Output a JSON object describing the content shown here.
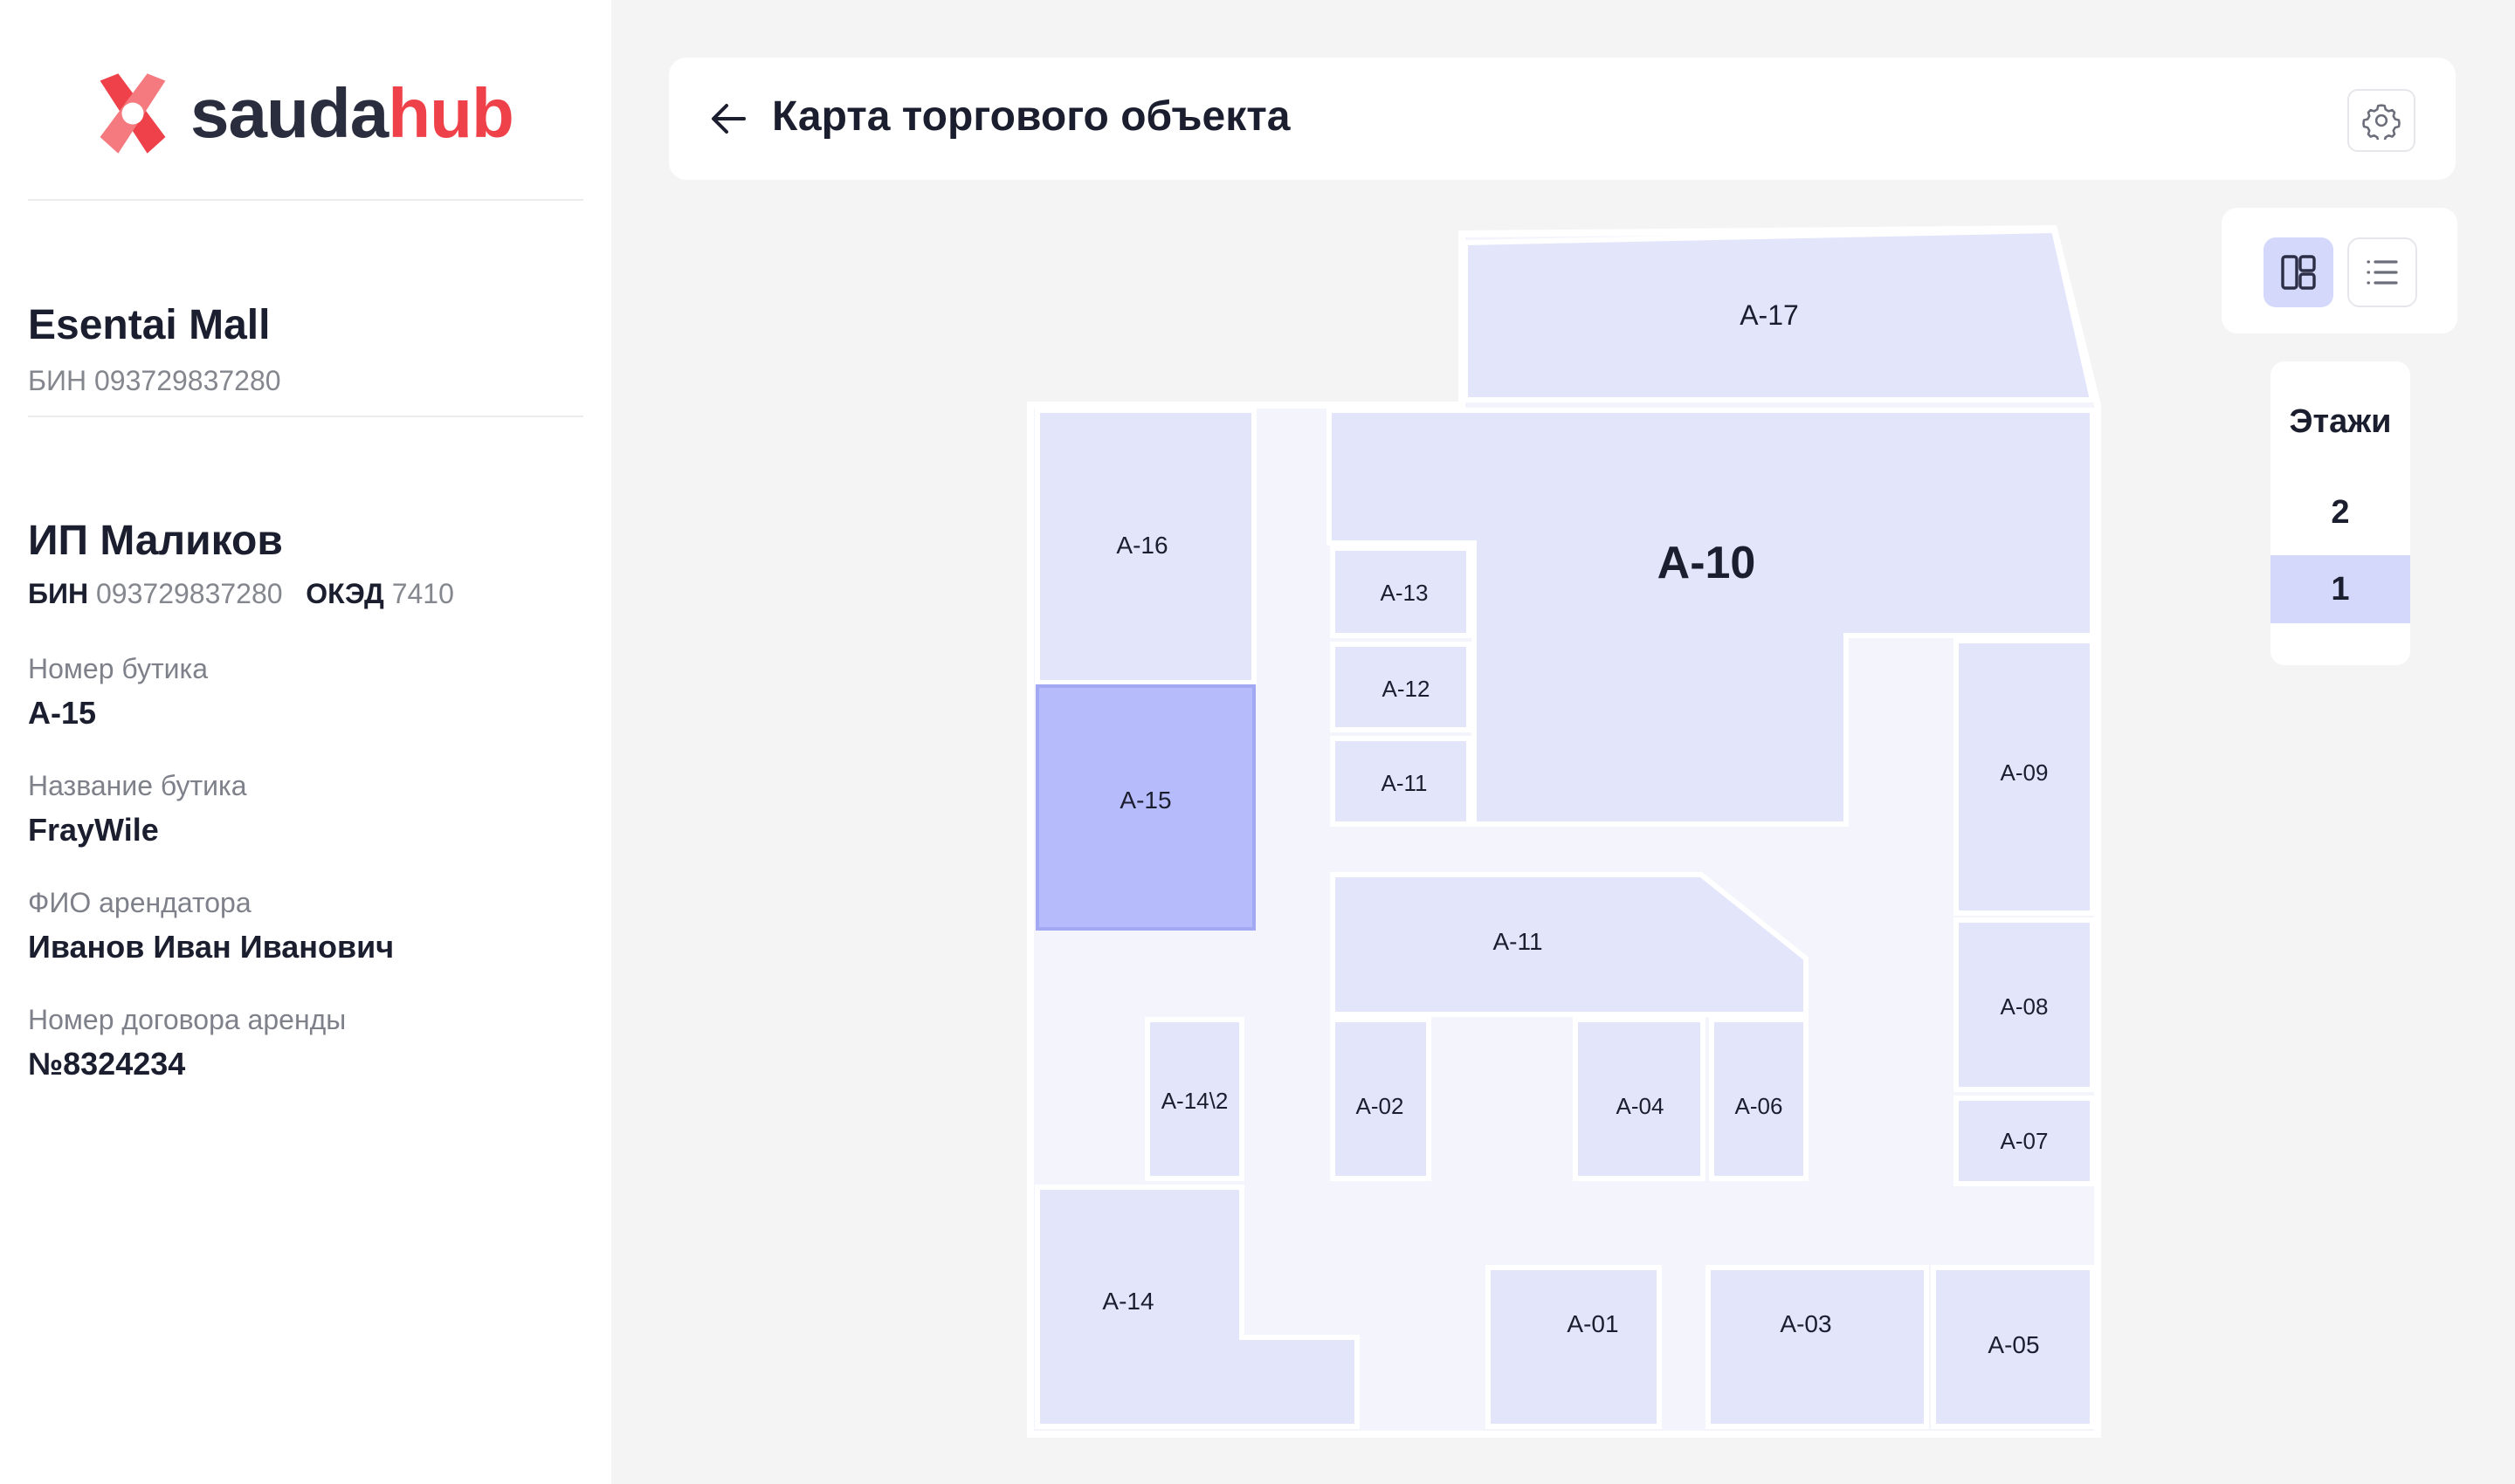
{
  "brand": {
    "name_part1": "sauda",
    "name_part2": "hub",
    "color_dark": "#2a2d3e",
    "color_accent": "#ef4149"
  },
  "mall": {
    "name": "Esentai Mall",
    "bin": "БИН 093729837280"
  },
  "tenant": {
    "name": "ИП Маликов",
    "bin_label": "БИН",
    "bin_value": "093729837280",
    "oked_label": "ОКЭД",
    "oked_value": "7410",
    "fields": [
      {
        "label": "Номер бутика",
        "value": "A-15"
      },
      {
        "label": "Название бутика",
        "value": "FrayWile"
      },
      {
        "label": "ФИО арендатора",
        "value": "Иванов Иван Иванович"
      },
      {
        "label": "Номер договора аренды",
        "value": "№8324234"
      }
    ]
  },
  "header": {
    "title": "Карта торгового объекта",
    "back_icon": "arrow-left-icon",
    "settings_icon": "gear-icon"
  },
  "view_toggle": {
    "active": "plan",
    "options": [
      "plan-view-icon",
      "list-view-icon"
    ]
  },
  "floors": {
    "title": "Этажи",
    "items": [
      "2",
      "1"
    ],
    "active": "1"
  },
  "map": {
    "selected_unit": "A-15",
    "colors": {
      "unit": "#e3e5fb",
      "selected": "#b5bbfb",
      "corridor": "#f3f4fc",
      "wall": "#ffffff"
    },
    "units": [
      "A-17",
      "A-16",
      "A-10",
      "A-13",
      "A-12",
      "A-11",
      "A-15",
      "A-09",
      "A-11",
      "A-08",
      "A-14\\2",
      "A-02",
      "A-04",
      "A-06",
      "A-07",
      "A-14",
      "A-01",
      "A-03",
      "A-05"
    ]
  }
}
